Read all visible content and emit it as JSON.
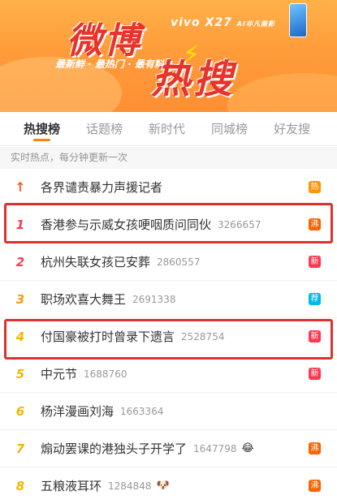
{
  "banner": {
    "title_top": "微博",
    "title_bottom": "热搜",
    "slogan": "最新鲜 · 最热门 · 最有料",
    "ad_text": "vivo X27",
    "ad_sub": "AI非凡摄影"
  },
  "tabs": [
    {
      "label": "热搜榜",
      "active": true
    },
    {
      "label": "话题榜"
    },
    {
      "label": "新时代"
    },
    {
      "label": "同城榜"
    },
    {
      "label": "好友搜"
    }
  ],
  "subtitle": "实时热点，每分钟更新一次",
  "items": [
    {
      "rank": "↑",
      "rank_type": "pin",
      "title": "各界谴责暴力声援记者",
      "count": "",
      "badge": "热",
      "badge_color": "#ff9406"
    },
    {
      "rank": "1",
      "rank_type": "top",
      "title": "香港参与示威女孩哽咽质问同伙",
      "count": "3266657",
      "badge": "沸",
      "badge_color": "#f86400"
    },
    {
      "rank": "2",
      "rank_type": "top",
      "title": "杭州失联女孩已安葬",
      "count": "2860557",
      "badge": "新",
      "badge_color": "#ff3852"
    },
    {
      "rank": "3",
      "rank_type": "third",
      "title": "职场欢喜大舞王",
      "count": "2691338",
      "badge": "荐",
      "badge_color": "#00b7ee"
    },
    {
      "rank": "4",
      "rank_type": "other",
      "title": "付国豪被打时曾录下遗言",
      "count": "2528754",
      "badge": "新",
      "badge_color": "#ff3852"
    },
    {
      "rank": "5",
      "rank_type": "other",
      "title": "中元节",
      "count": "1688760",
      "badge": "新",
      "badge_color": "#ff3852"
    },
    {
      "rank": "6",
      "rank_type": "other",
      "title": "杨洋漫画刘海",
      "count": "1663364",
      "badge": "",
      "badge_color": ""
    },
    {
      "rank": "7",
      "rank_type": "other",
      "title": "煽动罢课的港独头子开学了",
      "count": "1647798",
      "emoji": "😂",
      "badge": "沸",
      "badge_color": "#f86400"
    },
    {
      "rank": "8",
      "rank_type": "other",
      "title": "五粮液耳环",
      "count": "1284848",
      "emoji": "🐶",
      "badge": "沸",
      "badge_color": "#f86400"
    }
  ]
}
